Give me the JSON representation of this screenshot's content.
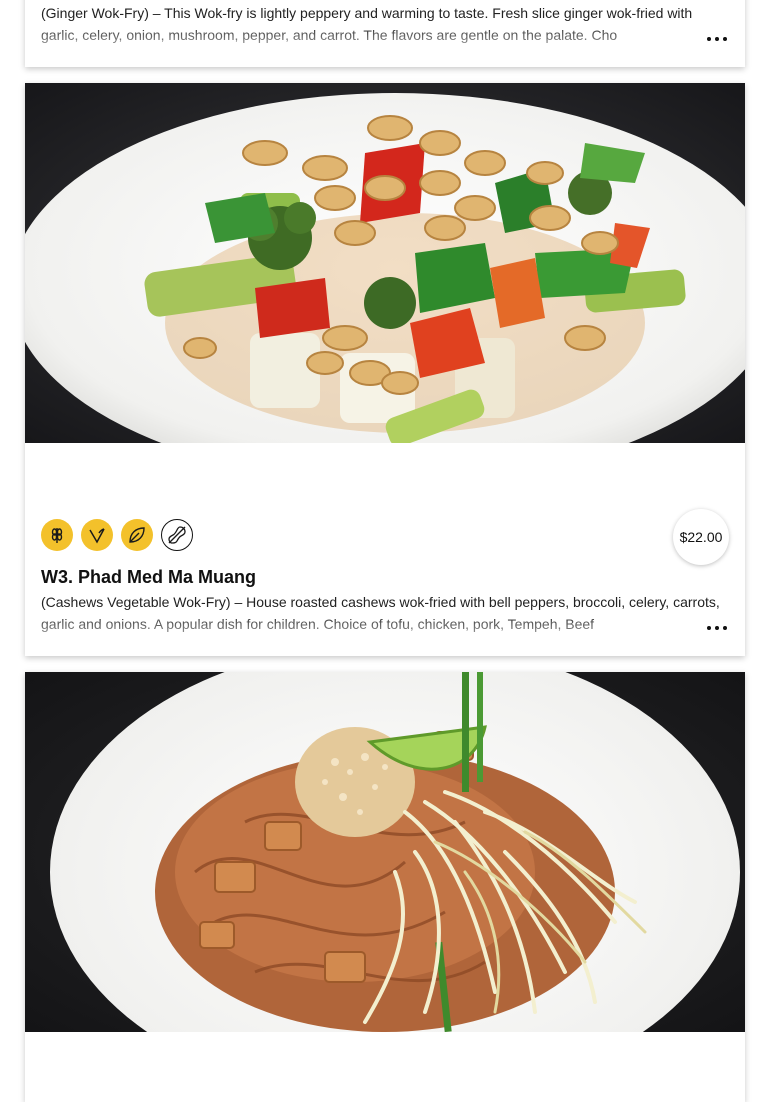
{
  "items": [
    {
      "description": "(Ginger Wok-Fry) – This Wok-fry is lightly peppery and warming to taste. Fresh slice ginger wok-fried with garlic, celery, onion, mushroom, pepper, and carrot. The flavors are gentle on the palate. Cho"
    },
    {
      "title": "W3. Phad Med Ma Muang",
      "price": "$22.00",
      "badges": [
        "gluten-free-icon",
        "vegan-icon",
        "vegetarian-icon",
        "peanut-icon"
      ],
      "description": "(Cashews Vegetable Wok-Fry) – House roasted cashews wok-fried with bell peppers, broccoli, celery, carrots, garlic and onions. A popular dish for children. Choice of tofu, chicken, pork, Tempeh, Beef"
    },
    {
      "image_alt": "pad thai noodles"
    }
  ],
  "colors": {
    "badge_gold": "#f3c12b",
    "text": "#111111"
  }
}
